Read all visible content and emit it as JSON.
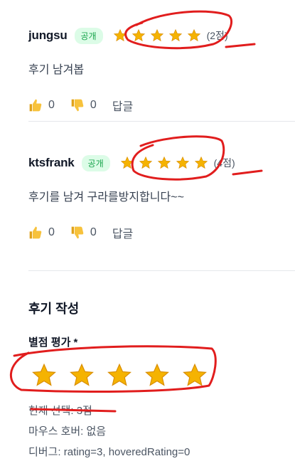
{
  "reviews": [
    {
      "username": "jungsu",
      "visibility": "공개",
      "rating": 2,
      "score_text": "(2점)",
      "content": "후기 남겨봅",
      "likes": "0",
      "dislikes": "0",
      "reply_label": "답글"
    },
    {
      "username": "ktsfrank",
      "visibility": "공개",
      "rating": 4,
      "score_text": "(4점)",
      "content": "후기를 남겨 구라를방지합니다~~",
      "likes": "0",
      "dislikes": "0",
      "reply_label": "답글"
    }
  ],
  "write": {
    "title": "후기 작성",
    "rating_label": "별점 평가 *",
    "current_selection": "현재 선택: 3점",
    "hover_status": "마우스 호버: 없음",
    "debug": "디버그: rating=3, hoveredRating=0",
    "selected_rating": 3
  },
  "colors": {
    "star": "#f5b301",
    "star_dark": "#d98e04",
    "badge_bg": "#dcfce7",
    "badge_text": "#16a34a",
    "annotation": "#e11d1d"
  },
  "icons": {
    "star": "star-icon",
    "like": "thumbs-up-icon",
    "dislike": "thumbs-down-icon"
  }
}
